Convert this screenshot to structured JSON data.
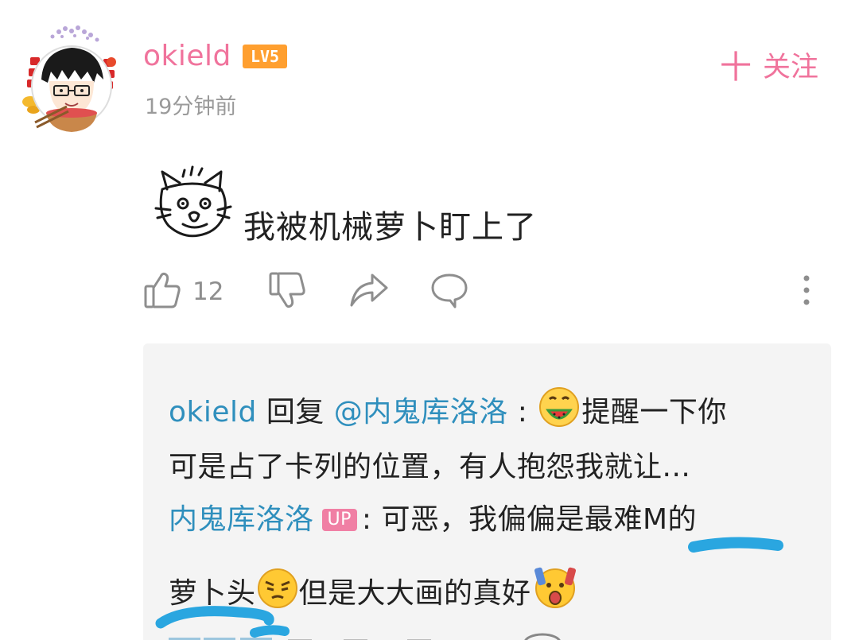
{
  "comment": {
    "username": "okield",
    "level_badge": "LV5",
    "timestamp": "19分钟前",
    "follow_label": "关注",
    "follow_plus": "十",
    "text": "我被机械萝卜盯上了",
    "like_count": "12"
  },
  "reply": {
    "line1_user": "okield",
    "line1_action": " 回复 ",
    "line1_mention": "@内鬼库洛洛",
    "line1_colon": " :",
    "line1_text": "提醒一下你",
    "line2_text": "可是占了卡列的位置，有人抱怨我就让...",
    "line3_user": "内鬼库洛洛",
    "line3_badge": "UP",
    "line3_text": ": 可恶，我偏偏是最难M的",
    "line4_text_a": "萝卜头",
    "line4_text_b": "但是大大画的真好"
  },
  "colors": {
    "accent_pink": "#f0739c",
    "link_blue": "#2f8fbd",
    "level_orange": "#ff9f2f",
    "scribble_blue": "#2aa6e0",
    "reply_bg": "#f4f4f4"
  },
  "icons": {
    "like": "thumbs-up-icon",
    "dislike": "thumbs-down-icon",
    "share": "share-icon",
    "reply": "comment-bubble-icon",
    "more": "more-vertical-icon"
  }
}
